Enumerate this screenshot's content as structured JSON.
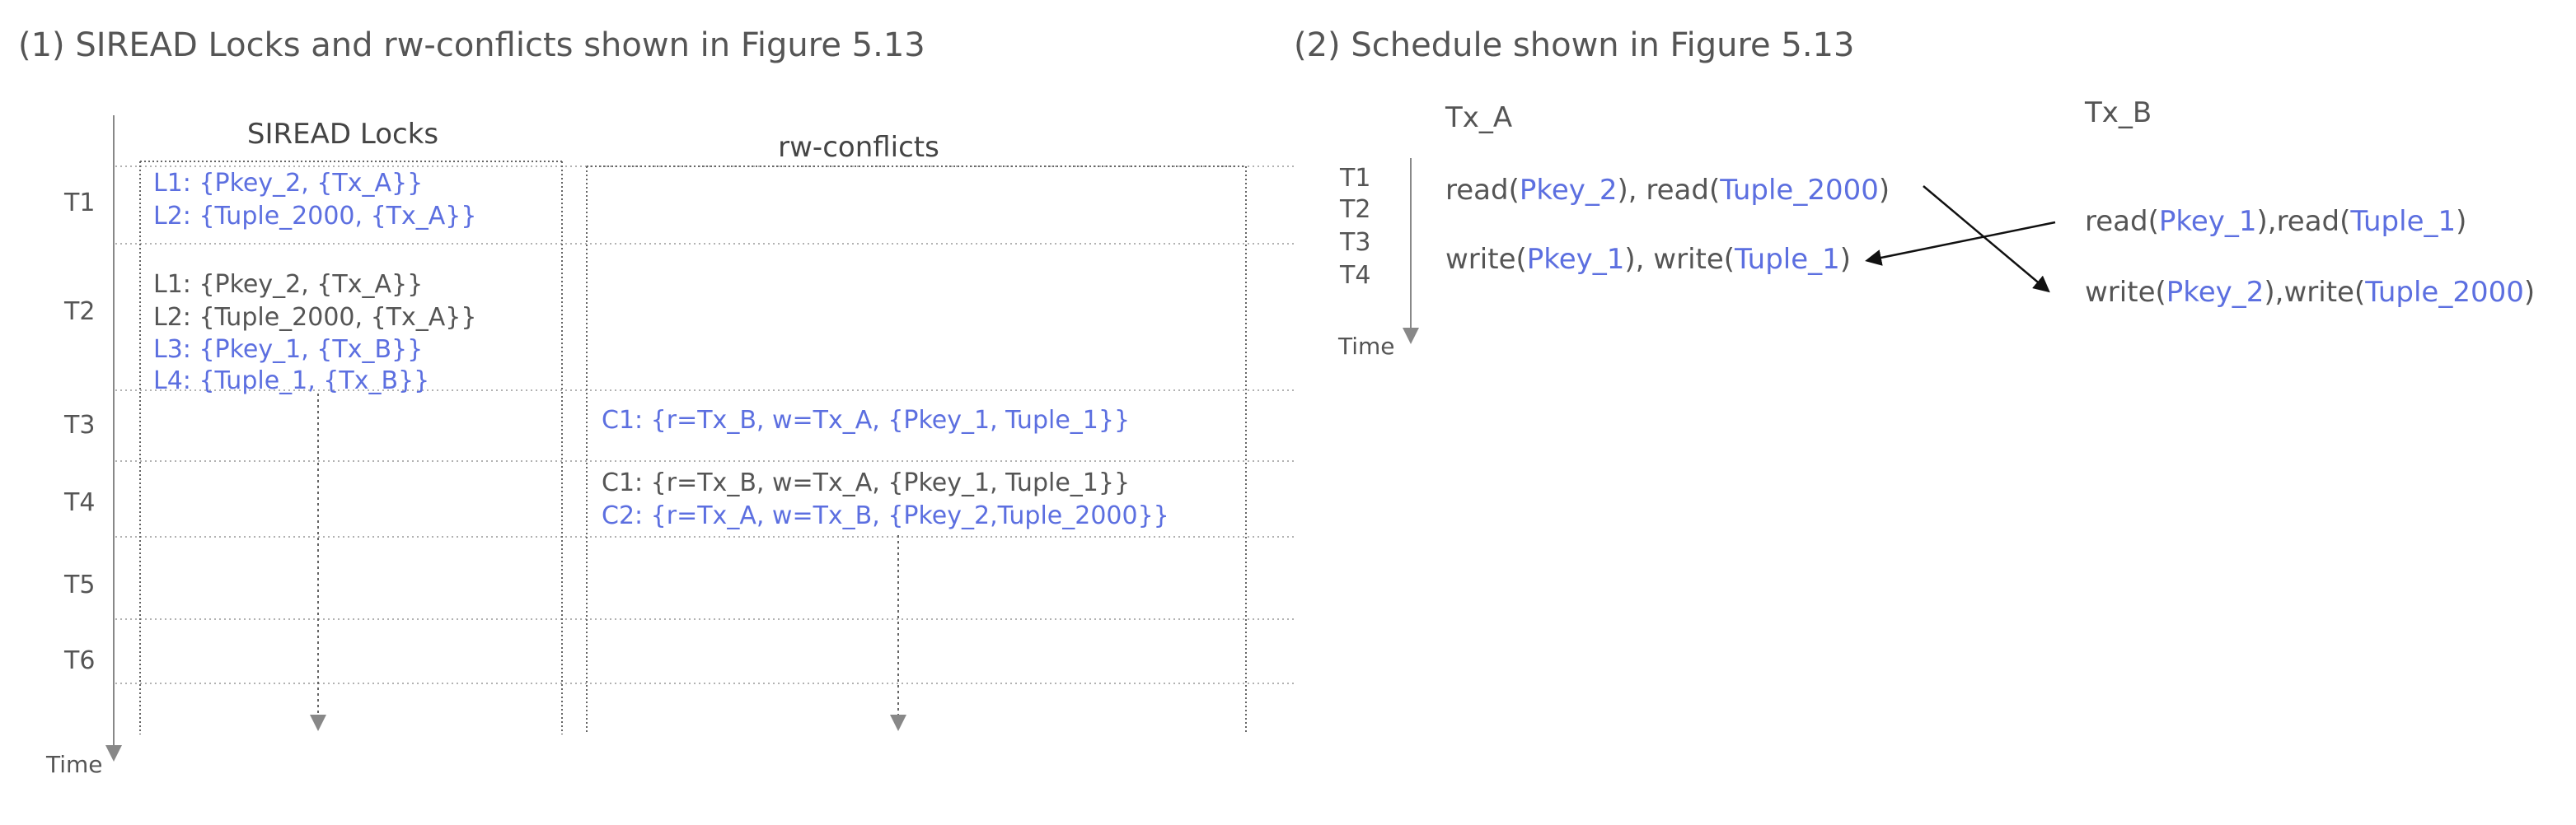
{
  "left_title": "(1) SIREAD Locks and rw-conflicts  shown in Figure 5.13",
  "right_title": "(2) Schedule shown in Figure 5.13",
  "siread_header": "SIREAD Locks",
  "rw_header": "rw-conflicts",
  "time_rows": [
    "T1",
    "T2",
    "T3",
    "T4",
    "T5",
    "T6"
  ],
  "time_label": "Time",
  "locks": {
    "t1": [
      "L1:  {Pkey_2,  {Tx_A}}",
      "L2:  {Tuple_2000,  {Tx_A}}"
    ],
    "t2": [
      "L1:  {Pkey_2,  {Tx_A}}",
      "L2:  {Tuple_2000,  {Tx_A}}",
      "L3:  {Pkey_1,  {Tx_B}}",
      "L4:  {Tuple_1,  {Tx_B}}"
    ]
  },
  "conflicts": {
    "t3": "C1:  {r=Tx_B,  w=Tx_A,  {Pkey_1,  Tuple_1}}",
    "t4": [
      "C1:  {r=Tx_B,  w=Tx_A,  {Pkey_1,  Tuple_1}}",
      "C2:  {r=Tx_A,  w=Tx_B,  {Pkey_2,Tuple_2000}}"
    ]
  },
  "schedule": {
    "tx_a": "Tx_A",
    "tx_b": "Tx_B",
    "rows": [
      "T1",
      "T2",
      "T3",
      "T4"
    ],
    "time_label": "Time",
    "a_read": {
      "p1": "read(",
      "k1": "Pkey_2",
      "p2": "), read(",
      "k2": "Tuple_2000",
      "p3": ")"
    },
    "a_write": {
      "p1": "write(",
      "k1": "Pkey_1",
      "p2": "), write(",
      "k2": "Tuple_1",
      "p3": ")"
    },
    "b_read": {
      "p1": "read(",
      "k1": "Pkey_1",
      "p2": "),read(",
      "k2": "Tuple_1",
      "p3": ")"
    },
    "b_write": {
      "p1": "write(",
      "k1": "Pkey_2",
      "p2": "),write(",
      "k2": "Tuple_2000",
      "p3": ")"
    }
  },
  "colors": {
    "highlight": "#5c6fe0",
    "text": "#555555"
  }
}
